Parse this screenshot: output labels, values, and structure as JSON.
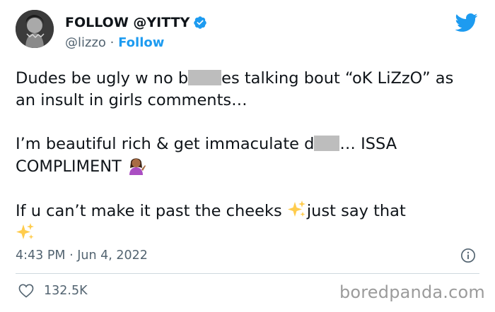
{
  "author": {
    "display_name": "FOLLOW @YITTY",
    "handle": "@lizzo",
    "separator": " · ",
    "follow_label": "Follow"
  },
  "tweet": {
    "p1_a": "Dudes be ugly w no b",
    "p1_b": "es talking bout “oK LiZzO” as an insult in girls comments…",
    "p2_a": "I’m beautiful rich & get immaculate d",
    "p2_b": "… ISSA COMPLIMENT ",
    "p3_a": "If u can’t make it past the cheeks ",
    "p3_b": "just say that",
    "emoji_sparkles": "sparkles-icon",
    "emoji_shrug": "woman-tipping-hand-emoji"
  },
  "meta": {
    "timestamp": "4:43 PM · Jun 4, 2022",
    "like_count": "132.5K"
  },
  "watermark": "boredpanda.com",
  "colors": {
    "twitter_blue": "#1d9bf0",
    "text": "#0f1419",
    "muted": "#536471",
    "redaction": "#bdbdbd",
    "watermark": "#9b9b9b"
  }
}
